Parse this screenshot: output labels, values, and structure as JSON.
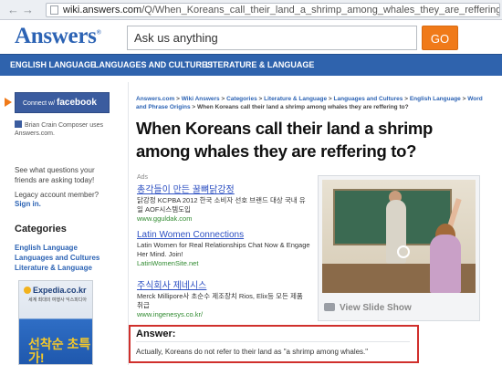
{
  "browser": {
    "url_host": "wiki.answers.com",
    "url_path": "/Q/When_Koreans_call_their_land_a_shrimp_among_whales_they_are_reffering_to"
  },
  "header": {
    "logo": "Answers",
    "logo_mark": "®",
    "search_placeholder": "Ask us anything",
    "go_label": "GO"
  },
  "topnav": [
    "ENGLISH LANGUAGE",
    "LANGUAGES AND CULTURES",
    "LITERATURE & LANGUAGE"
  ],
  "sidebar": {
    "connect_prefix": "Connect w/",
    "connect_brand": "facebook",
    "fb_user_text": "Brian Crain Composer uses Answers.com.",
    "see_text": "See what questions your friends are asking today!",
    "legacy_text": "Legacy account member?",
    "signin": "Sign in.",
    "categories_title": "Categories",
    "categories": [
      "English Language",
      "Languages and Cultures",
      "Literature & Language"
    ]
  },
  "expedia_ad": {
    "logo": "Expedia.co.kr",
    "sub": "세계 최대의 여행사 익스피디아",
    "headline": "선착순 초특가!"
  },
  "breadcrumb": {
    "items": [
      "Answers.com",
      "Wiki Answers",
      "Categories",
      "Literature & Language",
      "Languages and Cultures",
      "English Language",
      "Word and Phrase Origins"
    ],
    "sep": " > ",
    "current": "When Koreans call their land a shrimp among whales they are reffering to?"
  },
  "question": "When Koreans call their land a shrimp among whales they are reffering to?",
  "ads": {
    "label": "Ads",
    "items": [
      {
        "title": "총각들이 만든 꿀뼈닭강정",
        "desc": "닭강정 KCPBA 2012 한국 소비자 선호 브랜드 대상 국내 유일 AOF시스템도입",
        "url": "www.gguldak.com"
      },
      {
        "title": "Latin Women Connections",
        "desc": "Latin Women for Real Relationships Chat Now & Engage Her Mind. Join!",
        "url": "LatinWomenSite.net"
      },
      {
        "title": "주식회사 제네시스",
        "desc": "Merck Millipore사 초순수 제조장치 Rios, Elix등 모든 제품 취급",
        "url": "www.ingenesys.co.kr/"
      }
    ]
  },
  "slideshow": {
    "caption": "View Slide Show"
  },
  "answer": {
    "heading": "Answer:",
    "text": "Actually, Koreans do not refer to their land as \"a shrimp among whales.\""
  }
}
